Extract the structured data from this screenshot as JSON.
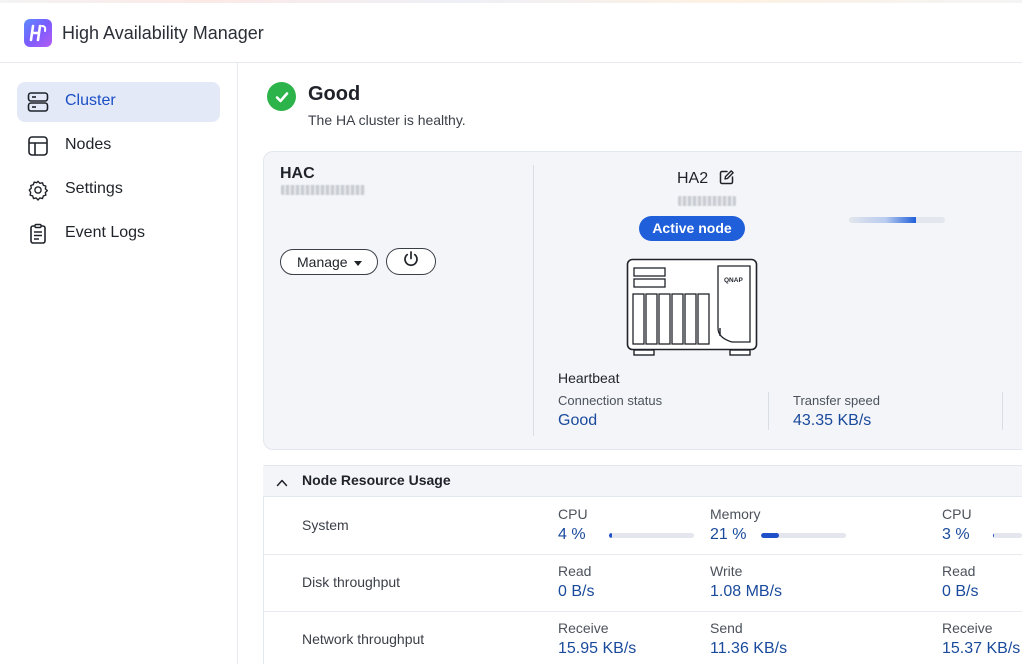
{
  "app": {
    "title": "High Availability Manager",
    "logo": "ha-logo-icon"
  },
  "sidebar": {
    "items": [
      {
        "label": "Cluster",
        "icon": "server-stack-icon",
        "active": true
      },
      {
        "label": "Nodes",
        "icon": "nodes-icon",
        "active": false
      },
      {
        "label": "Settings",
        "icon": "gear-icon",
        "active": false
      },
      {
        "label": "Event Logs",
        "icon": "log-icon",
        "active": false
      }
    ]
  },
  "status": {
    "title": "Good",
    "message": "The HA cluster is healthy.",
    "color": "#2cb34a"
  },
  "cluster": {
    "name": "HAC",
    "manage_label": "Manage",
    "node": {
      "name": "HA2",
      "badge": "Active node",
      "brand": "QNAP"
    },
    "sync_progress": 0.7
  },
  "heartbeat": {
    "title": "Heartbeat",
    "connection_label": "Connection status",
    "connection_value": "Good",
    "speed_label": "Transfer speed",
    "speed_value": "43.35 KB/s"
  },
  "usage": {
    "title": "Node Resource Usage",
    "rows": [
      {
        "label": "System",
        "metrics": [
          {
            "label": "CPU",
            "value": "4 %",
            "level": 0.04
          },
          {
            "label": "Memory",
            "value": "21 %",
            "level": 0.21
          },
          {
            "label": "CPU",
            "value": "3 %",
            "level": 0.03
          }
        ]
      },
      {
        "label": "Disk throughput",
        "metrics": [
          {
            "label": "Read",
            "value": "0 B/s"
          },
          {
            "label": "Write",
            "value": "1.08 MB/s"
          },
          {
            "label": "Read",
            "value": "0 B/s"
          }
        ]
      },
      {
        "label": "Network throughput",
        "metrics": [
          {
            "label": "Receive",
            "value": "15.95 KB/s"
          },
          {
            "label": "Send",
            "value": "11.36 KB/s"
          },
          {
            "label": "Receive",
            "value": "15.37 KB/s"
          }
        ]
      }
    ]
  },
  "colors": {
    "accent": "#1f5fd9",
    "value_text": "#1a4a9c",
    "nav_active_bg": "#e4e9f8"
  }
}
